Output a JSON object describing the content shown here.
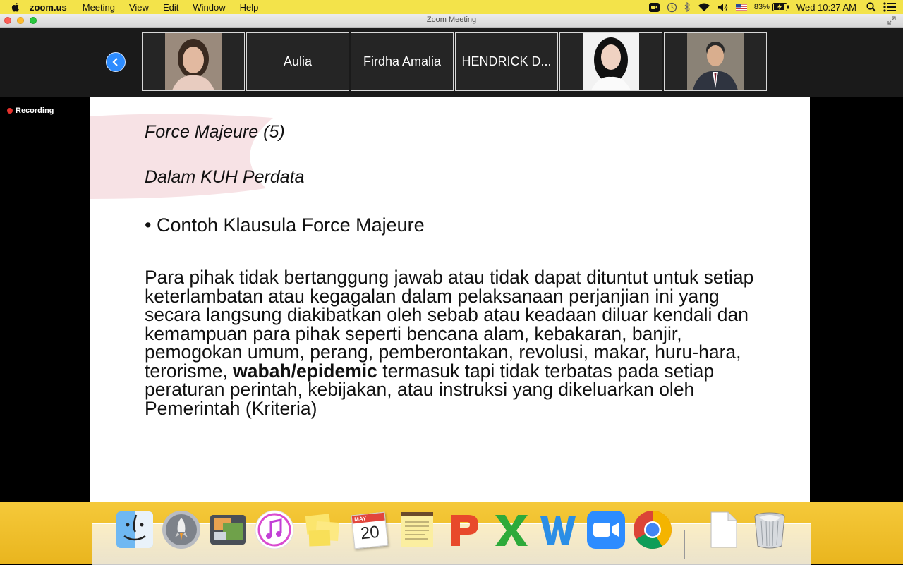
{
  "menubar": {
    "app": "zoom.us",
    "items": [
      "Meeting",
      "View",
      "Edit",
      "Window",
      "Help"
    ],
    "battery": "83%",
    "clock": "Wed 10:27 AM"
  },
  "window": {
    "title": "Zoom Meeting"
  },
  "participants": {
    "tiles": [
      {
        "name": ""
      },
      {
        "name": "Aulia"
      },
      {
        "name": "Firdha Amalia"
      },
      {
        "name": "HENDRICK D..."
      },
      {
        "name": ""
      },
      {
        "name": ""
      }
    ]
  },
  "recording": {
    "label": "Recording"
  },
  "slide": {
    "title": "Force Majeure (5)",
    "subtitle": "Dalam KUH Perdata",
    "bullet": "• Contoh Klausula Force Majeure",
    "para_before": "Para pihak tidak bertanggung jawab atau tidak dapat dituntut untuk setiap keterlambatan atau kegagalan dalam pelaksanaan perjanjian ini yang secara langsung diakibatkan oleh sebab atau keadaan diluar kendali dan kemampuan para pihak seperti bencana alam, kebakaran, banjir, pemogokan umum, perang, pemberontakan, revolusi, makar, huru-hara, terorisme, ",
    "para_bold": "wabah/epidemic",
    "para_after": " termasuk tapi tidak terbatas pada setiap peraturan perintah, kebijakan, atau instruksi yang dikeluarkan oleh Pemerintah  (Kriteria)"
  },
  "dock": {
    "calendar": {
      "month": "MAY",
      "day": "20"
    }
  },
  "colors": {
    "menubar": "#f3e34a",
    "accent": "#2d8cff",
    "recording": "#e5322d",
    "dock_bg": "#f5c93a"
  }
}
